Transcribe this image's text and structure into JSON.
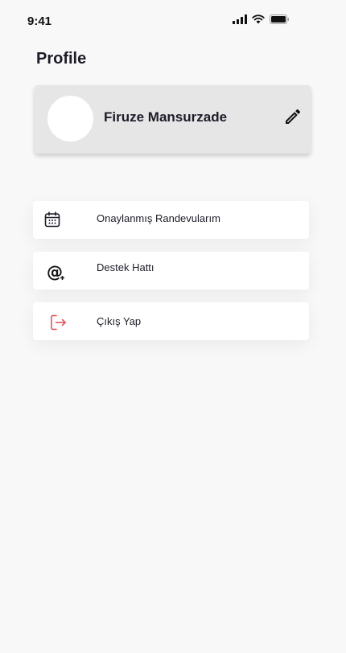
{
  "status_bar": {
    "time": "9:41",
    "icons": [
      "signal-icon",
      "wifi-icon",
      "battery-icon"
    ]
  },
  "page": {
    "title": "Profile"
  },
  "profile": {
    "name": "Firuze Mansurzade",
    "edit_icon": "pencil-icon"
  },
  "menu": {
    "items": [
      {
        "label": "Onaylanmış Randevularım",
        "icon": "calendar-icon"
      },
      {
        "label": "Destek Hattı",
        "icon": "at-sign-icon"
      },
      {
        "label": "Çıkış Yap",
        "icon": "logout-icon",
        "icon_color": "#e5484d"
      }
    ]
  }
}
